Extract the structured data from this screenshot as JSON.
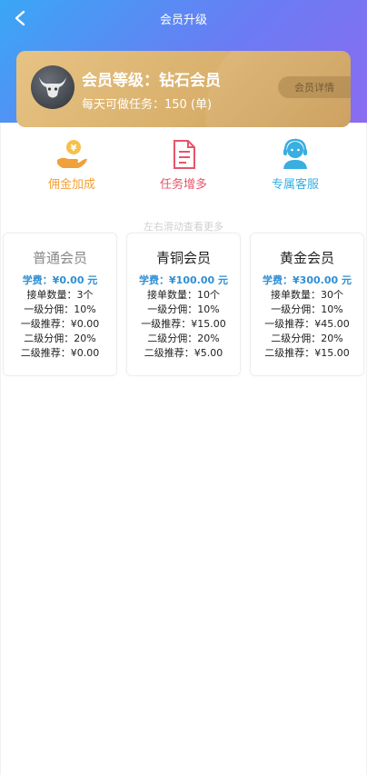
{
  "topbar": {
    "title": "会员升级",
    "back_icon": "chevron-left-icon"
  },
  "member": {
    "level_label": "会员等级：钻石会员",
    "tasks_label": "每天可做任务：150 (单)",
    "detail_button": "会员详情",
    "avatar_icon": "bull-head-icon"
  },
  "features": [
    {
      "label": "佣金加成",
      "icon": "coin-hand-icon",
      "color": "#efa13b"
    },
    {
      "label": "任务增多",
      "icon": "document-icon",
      "color": "#e65569"
    },
    {
      "label": "专属客服",
      "icon": "customer-service-icon",
      "color": "#39aee0"
    }
  ],
  "hint": "左右滑动查看更多",
  "plans": [
    {
      "name": "普通会员",
      "fee": "学费：¥0.00 元",
      "rows": [
        "接单数量：3个",
        "一级分佣：10%",
        "一级推荐：¥0.00",
        "二级分佣：20%",
        "二级推荐：¥0.00"
      ]
    },
    {
      "name": "青铜会员",
      "fee": "学费：¥100.00 元",
      "rows": [
        "接单数量：10个",
        "一级分佣：10%",
        "一级推荐：¥15.00",
        "二级分佣：20%",
        "二级推荐：¥5.00"
      ]
    },
    {
      "name": "黄金会员",
      "fee": "学费：¥300.00 元",
      "rows": [
        "接单数量：30个",
        "一级分佣：10%",
        "一级推荐：¥45.00",
        "二级分佣：20%",
        "二级推荐：¥15.00"
      ]
    }
  ],
  "colors": {
    "header_start": "#3aa7f5",
    "header_end": "#8b6bf1",
    "card_gold": "#d9b06c",
    "fee_blue": "#2f8fd4"
  }
}
